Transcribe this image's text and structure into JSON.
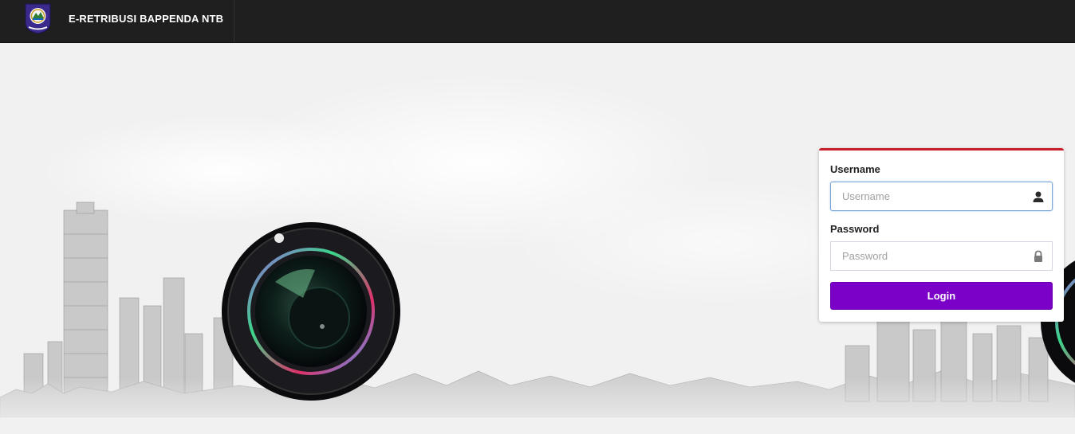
{
  "header": {
    "title": "E-RETRIBUSI BAPPENDA NTB",
    "logo_icon": "province-emblem-icon"
  },
  "login": {
    "username_label": "Username",
    "username_placeholder": "Username",
    "username_value": "",
    "username_icon": "user-icon",
    "password_label": "Password",
    "password_placeholder": "Password",
    "password_value": "",
    "password_icon": "lock-icon",
    "submit_label": "Login"
  },
  "colors": {
    "navbar": "#1f1f1f",
    "accent_top_border": "#c81d2a",
    "login_button": "#7b00c8"
  }
}
